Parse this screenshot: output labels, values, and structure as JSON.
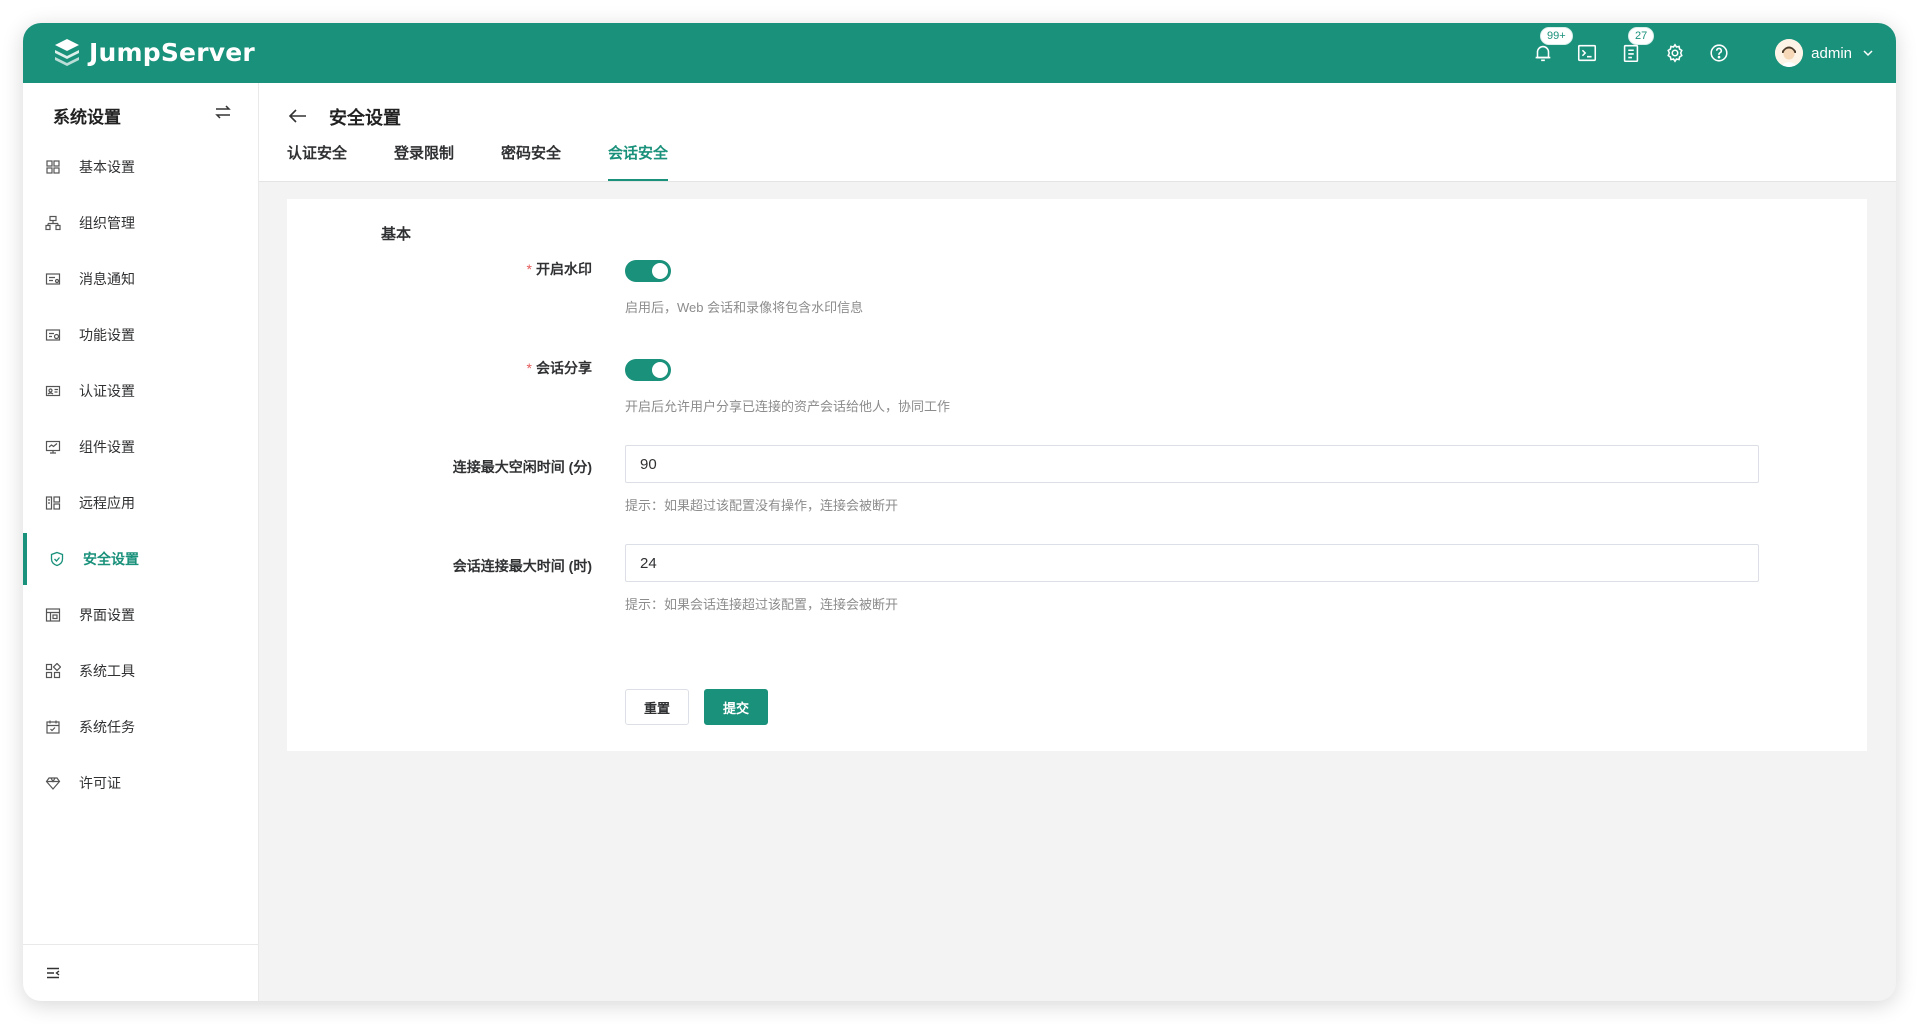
{
  "app": {
    "brand": "JumpServer"
  },
  "header": {
    "notifications_badge": "99+",
    "messages_badge": "27",
    "user_name": "admin",
    "icons": [
      "bell-icon",
      "terminal-icon",
      "clipboard-icon",
      "gear-icon",
      "help-icon"
    ]
  },
  "sidebar": {
    "title": "系统设置",
    "items": [
      {
        "label": "基本设置",
        "icon": "grid-icon"
      },
      {
        "label": "组织管理",
        "icon": "org-icon"
      },
      {
        "label": "消息通知",
        "icon": "message-icon"
      },
      {
        "label": "功能设置",
        "icon": "feature-icon"
      },
      {
        "label": "认证设置",
        "icon": "id-card-icon"
      },
      {
        "label": "组件设置",
        "icon": "monitor-icon"
      },
      {
        "label": "远程应用",
        "icon": "apps-icon"
      },
      {
        "label": "安全设置",
        "icon": "shield-icon"
      },
      {
        "label": "界面设置",
        "icon": "layout-icon"
      },
      {
        "label": "系统工具",
        "icon": "tools-icon"
      },
      {
        "label": "系统任务",
        "icon": "calendar-icon"
      },
      {
        "label": "许可证",
        "icon": "diamond-icon"
      }
    ],
    "active_index": 7
  },
  "page": {
    "title": "安全设置",
    "tabs": [
      {
        "label": "认证安全"
      },
      {
        "label": "登录限制"
      },
      {
        "label": "密码安全"
      },
      {
        "label": "会话安全"
      }
    ],
    "active_tab": 3
  },
  "form": {
    "section_title": "基本",
    "watermark": {
      "label": "开启水印",
      "required_mark": "*",
      "enabled": true,
      "help": "启用后，Web 会话和录像将包含水印信息"
    },
    "session_share": {
      "label": "会话分享",
      "required_mark": "*",
      "enabled": true,
      "help": "开启后允许用户分享已连接的资产会话给他人，协同工作"
    },
    "idle_timeout": {
      "label": "连接最大空闲时间 (分)",
      "value": "90",
      "help": "提示：如果超过该配置没有操作，连接会被断开"
    },
    "max_session": {
      "label": "会话连接最大时间 (时)",
      "value": "24",
      "help": "提示：如果会话连接超过该配置，连接会被断开"
    },
    "reset_label": "重置",
    "submit_label": "提交"
  },
  "colors": {
    "primary": "#1a917b",
    "required": "#e45a5a"
  }
}
